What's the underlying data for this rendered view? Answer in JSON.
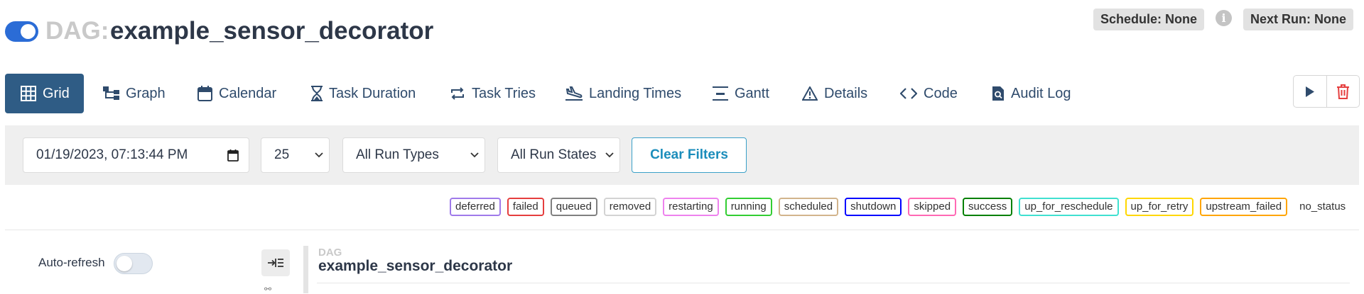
{
  "header": {
    "toggle_state": "on",
    "dag_prefix": "DAG:",
    "dag_id": "example_sensor_decorator",
    "schedule": "Schedule: None",
    "info_icon": "info-icon",
    "next_run": "Next Run: None"
  },
  "tabs": [
    {
      "label": "Grid",
      "icon": "grid-icon",
      "active": true
    },
    {
      "label": "Graph",
      "icon": "graph-icon",
      "active": false
    },
    {
      "label": "Calendar",
      "icon": "calendar-icon",
      "active": false
    },
    {
      "label": "Task Duration",
      "icon": "hourglass-icon",
      "active": false
    },
    {
      "label": "Task Tries",
      "icon": "retry-icon",
      "active": false
    },
    {
      "label": "Landing Times",
      "icon": "plane-landing-icon",
      "active": false
    },
    {
      "label": "Gantt",
      "icon": "gantt-icon",
      "active": false
    },
    {
      "label": "Details",
      "icon": "warning-triangle-icon",
      "active": false
    },
    {
      "label": "Code",
      "icon": "code-icon",
      "active": false
    },
    {
      "label": "Audit Log",
      "icon": "audit-log-icon",
      "active": false
    }
  ],
  "actions": {
    "trigger_icon": "play-icon",
    "delete_icon": "trash-icon",
    "delete_color": "#e53e3e"
  },
  "filters": {
    "base_date": "01/19/2023, 07:13:44 PM",
    "num_runs": "25",
    "run_type": "All Run Types",
    "run_state": "All Run States",
    "clear_label": "Clear Filters"
  },
  "legend": [
    {
      "label": "deferred",
      "color": "#9f7aea"
    },
    {
      "label": "failed",
      "color": "#e53e3e"
    },
    {
      "label": "queued",
      "color": "#808080"
    },
    {
      "label": "removed",
      "color": "#d3d3d3"
    },
    {
      "label": "restarting",
      "color": "#ee82ee"
    },
    {
      "label": "running",
      "color": "#32cd32"
    },
    {
      "label": "scheduled",
      "color": "#d2b48c"
    },
    {
      "label": "shutdown",
      "color": "#0000ff"
    },
    {
      "label": "skipped",
      "color": "#ff69b4"
    },
    {
      "label": "success",
      "color": "#008000"
    },
    {
      "label": "up_for_reschedule",
      "color": "#40e0d0"
    },
    {
      "label": "up_for_retry",
      "color": "#ffd700"
    },
    {
      "label": "upstream_failed",
      "color": "#ffa500"
    },
    {
      "label": "no_status",
      "color": ""
    }
  ],
  "bottom": {
    "auto_refresh_label": "Auto-refresh",
    "auto_refresh_state": "off",
    "collapse_icon": "collapse-icon",
    "dag_label": "DAG",
    "dag_name": "example_sensor_decorator"
  }
}
